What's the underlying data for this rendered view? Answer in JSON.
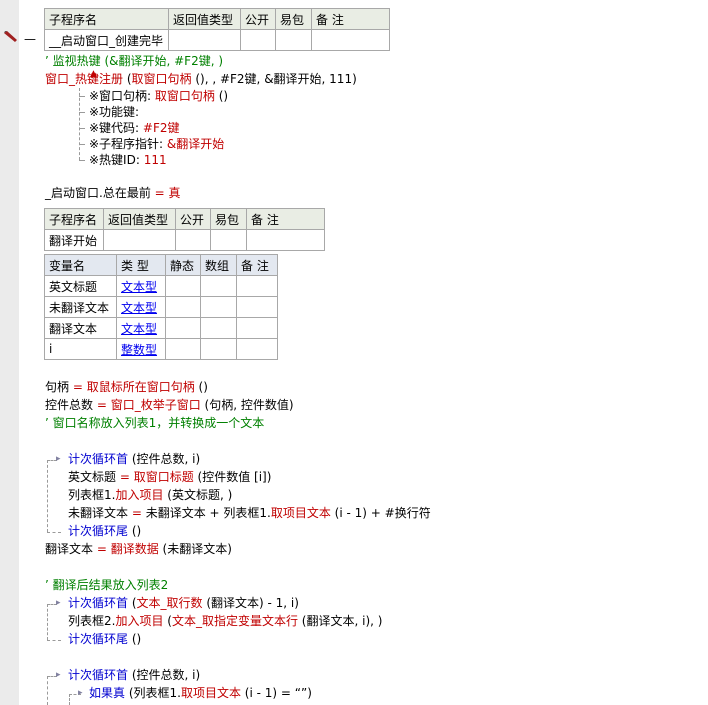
{
  "sub1": {
    "headers": [
      "子程序名",
      "返回值类型",
      "公开",
      "易包",
      "备 注"
    ],
    "name": "__启动窗口_创建完毕"
  },
  "code1": {
    "comment": "’ 监视热键 (&翻译开始, #F2键, )",
    "l2a": "窗口_热键注册",
    "l2b": " (",
    "l2c": "取窗口句柄",
    "l2d": " (), , #F2键, &翻译开始, 111)",
    "p1a": "※窗口句柄: ",
    "p1b": "取窗口句柄",
    "p1c": " ()",
    "p2": "※功能键:",
    "p3a": "※键代码: ",
    "p3b": "#F2键",
    "p4a": "※子程序指针: ",
    "p4b": "&翻译开始",
    "p5a": "※热键ID: ",
    "p5b": "111",
    "top1": "_启动窗口.总在最前 ",
    "top2": "= ",
    "top3": "真"
  },
  "sub2": {
    "headers": [
      "子程序名",
      "返回值类型",
      "公开",
      "易包",
      "备 注"
    ],
    "name": "翻译开始"
  },
  "vars": {
    "headers": [
      "变量名",
      "类 型",
      "静态",
      "数组",
      "备 注"
    ],
    "rows": [
      {
        "name": "英文标题",
        "type": "文本型"
      },
      {
        "name": "未翻译文本",
        "type": "文本型"
      },
      {
        "name": "翻译文本",
        "type": "文本型"
      },
      {
        "name": "i",
        "type": "整数型"
      }
    ]
  },
  "code2": {
    "h1": "句柄 ",
    "h2": "= ",
    "h3": "取鼠标所在窗口句柄",
    "h4": " ()",
    "c1": "控件总数 ",
    "c2": "= ",
    "c3": "窗口_枚举子窗口",
    "c4": " (句柄, 控件数值)",
    "comment1": "’ 窗口名称放入列表1，并转换成一个文本",
    "for1a": "计次循环首",
    "for1b": " (控件总数, i)",
    "t1a": "英文标题 ",
    "t1b": "= ",
    "t1c": "取窗口标题",
    "t1d": " (控件数值 [i])",
    "t2a": "列表框1.",
    "t2b": "加入项目",
    "t2c": " (英文标题, )",
    "t3a": "未翻译文本 ",
    "t3b": "= ",
    "t3c": "未翻译文本 + 列表框1.",
    "t3d": "取项目文本",
    "t3e": " (i - 1) + #换行符",
    "end1": "计次循环尾",
    "end1b": " ()",
    "tr1": "翻译文本 ",
    "tr2": "= ",
    "tr3": "翻译数据",
    "tr4": " (未翻译文本)",
    "comment2": "’ 翻译后结果放入列表2",
    "for2a": "计次循环首",
    "for2b": " (",
    "for2c": "文本_取行数",
    "for2d": " (翻译文本) - 1, i)",
    "u1a": "列表框2.",
    "u1b": "加入项目",
    "u1c": " (",
    "u1d": "文本_取指定变量文本行",
    "u1e": " (翻译文本, i), )",
    "end2": "计次循环尾",
    "end2b": " ()",
    "for3a": "计次循环首",
    "for3b": " (控件总数, i)",
    "if1": "如果真",
    "if2": " (列表框1.",
    "if3": "取项目文本",
    "if4": " (i - 1) = “”)"
  }
}
